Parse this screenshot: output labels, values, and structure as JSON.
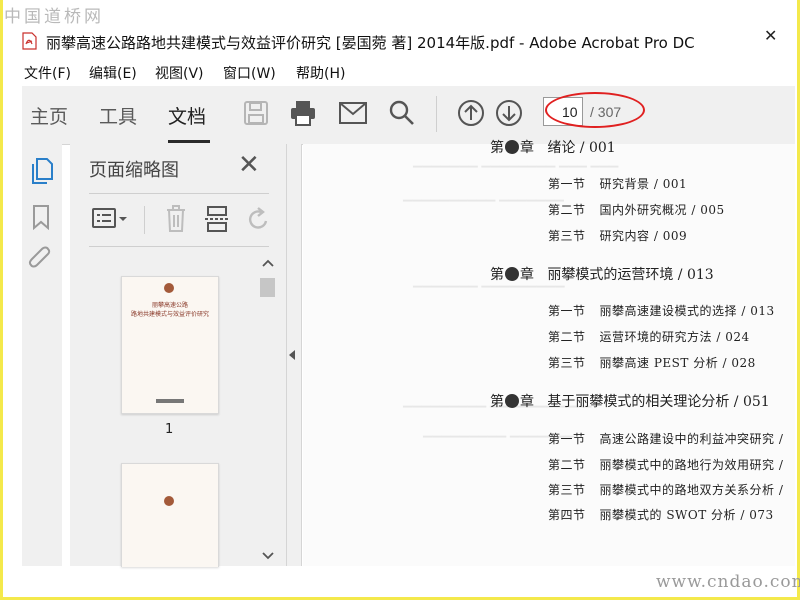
{
  "watermark_top": "中国道桥网",
  "watermark_bottom": "www.cndao.com",
  "window": {
    "title": "丽攀高速公路路地共建模式与效益评价研究 [晏国菀 著] 2014年版.pdf - Adobe Acrobat Pro DC",
    "close_glyph": "✕"
  },
  "menu": [
    "文件(F)",
    "编辑(E)",
    "视图(V)",
    "窗口(W)",
    "帮助(H)"
  ],
  "tabs": [
    "主页",
    "工具",
    "文档"
  ],
  "active_tab": "文档",
  "page_nav": {
    "current": "10",
    "total": "/ 307"
  },
  "thumbnails": {
    "title": "页面缩略图",
    "close_glyph": "✕",
    "page_label": "1",
    "cover_lines": [
      "丽攀高速公路",
      "路地共建模式与效益评价研究"
    ]
  },
  "toc": {
    "chapters": [
      {
        "prefix": "第",
        "suffix": "章",
        "title": "绪论 / 001",
        "sections": [
          {
            "num": "第一节",
            "text": "研究背景 / 001"
          },
          {
            "num": "第二节",
            "text": "国内外研究概况 / 005"
          },
          {
            "num": "第三节",
            "text": "研究内容 / 009"
          }
        ]
      },
      {
        "prefix": "第",
        "suffix": "章",
        "title": "丽攀模式的运营环境 / 013",
        "sections": [
          {
            "num": "第一节",
            "text": "丽攀高速建设模式的选择 / 013"
          },
          {
            "num": "第二节",
            "text": "运营环境的研究方法 / 024"
          },
          {
            "num": "第三节",
            "text": "丽攀高速 PEST 分析 / 028"
          }
        ]
      },
      {
        "prefix": "第",
        "suffix": "章",
        "title": "基于丽攀模式的相关理论分析 / 051",
        "sections": [
          {
            "num": "第一节",
            "text": "高速公路建设中的利益冲突研究 /"
          },
          {
            "num": "第二节",
            "text": "丽攀模式中的路地行为效用研究 /"
          },
          {
            "num": "第三节",
            "text": "丽攀模式中的路地双方关系分析 /"
          },
          {
            "num": "第四节",
            "text": "丽攀模式的 SWOT 分析 / 073"
          }
        ]
      }
    ]
  },
  "colors": {
    "accent_red": "#e02020",
    "toolbar_bg": "#f0f0f0",
    "frame_yellow": "#f4e94b"
  }
}
